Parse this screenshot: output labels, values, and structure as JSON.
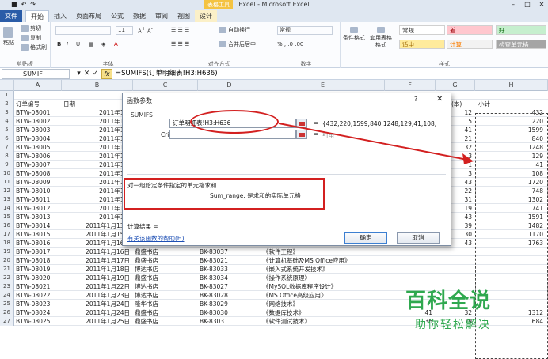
{
  "app": {
    "title": "Excel - Microsoft Excel",
    "context_tab": "表格工具",
    "qa_icons": [
      "save-icon",
      "undo-icon",
      "redo-icon"
    ]
  },
  "tabs": [
    "文件",
    "开始",
    "插入",
    "页面布局",
    "公式",
    "数据",
    "审阅",
    "视图",
    "设计"
  ],
  "ribbon": {
    "clipboard": {
      "cut": "剪切",
      "copy": "复制",
      "format_painter": "格式刷",
      "paste": "粘贴",
      "label": "剪贴板"
    },
    "font": {
      "size": "11",
      "bold": "B",
      "italic": "I",
      "underline": "U",
      "label": "字体"
    },
    "align": {
      "wrap": "自动换行",
      "merge": "合并后居中",
      "label": "对齐方式"
    },
    "number": {
      "format": "常规",
      "label": "数字"
    },
    "styles": {
      "cond": "条件格式",
      "table": "套用表格格式",
      "label": "样式",
      "boxes": [
        {
          "text": "常规",
          "bg": "#ffffff",
          "fg": "#333333"
        },
        {
          "text": "差",
          "bg": "#ffc7ce",
          "fg": "#9c0006"
        },
        {
          "text": "好",
          "bg": "#c6efce",
          "fg": "#006100"
        },
        {
          "text": "适中",
          "bg": "#ffeb9c",
          "fg": "#9c6500"
        },
        {
          "text": "计算",
          "bg": "#f2f2f2",
          "fg": "#fa7d00"
        },
        {
          "text": "检查单元格",
          "bg": "#a5a5a5",
          "fg": "#ffffff"
        }
      ]
    }
  },
  "formula_bar": {
    "name_box": "SUMIF",
    "cancel": "✕",
    "enter": "✓",
    "fx": "fx",
    "formula": "=SUMIFS(订单明细表!H3:H636)"
  },
  "columns": [
    "A",
    "B",
    "C",
    "D",
    "E",
    "F",
    "G",
    "H"
  ],
  "header_row": {
    "num": "2",
    "order": "订单编号",
    "date": "日期",
    "qty": "(本)",
    "subtotal": "小计"
  },
  "rows": [
    {
      "num": "3",
      "id": "BTW-08001",
      "date": "2011年1月",
      "store": "",
      "book": "",
      "title": "",
      "price": "",
      "qty": "12",
      "total": "432"
    },
    {
      "num": "4",
      "id": "BTW-08002",
      "date": "2011年1月",
      "store": "",
      "book": "",
      "title": "",
      "price": "",
      "qty": "5",
      "total": "220"
    },
    {
      "num": "5",
      "id": "BTW-08003",
      "date": "2011年1月",
      "store": "",
      "book": "",
      "title": "",
      "price": "",
      "qty": "41",
      "total": "1599"
    },
    {
      "num": "6",
      "id": "BTW-08004",
      "date": "2011年1月",
      "store": "",
      "book": "",
      "title": "",
      "price": "",
      "qty": "21",
      "total": "840"
    },
    {
      "num": "7",
      "id": "BTW-08005",
      "date": "2011年1月",
      "store": "",
      "book": "",
      "title": "",
      "price": "",
      "qty": "32",
      "total": "1248"
    },
    {
      "num": "8",
      "id": "BTW-08006",
      "date": "2011年1月",
      "store": "",
      "book": "",
      "title": "",
      "price": "",
      "qty": "3",
      "total": "129"
    },
    {
      "num": "9",
      "id": "BTW-08007",
      "date": "2011年1月",
      "store": "",
      "book": "",
      "title": "",
      "price": "",
      "qty": "1",
      "total": "41"
    },
    {
      "num": "10",
      "id": "BTW-08008",
      "date": "2011年1月",
      "store": "",
      "book": "",
      "title": "",
      "price": "",
      "qty": "3",
      "total": "108"
    },
    {
      "num": "11",
      "id": "BTW-08009",
      "date": "2011年1月",
      "store": "",
      "book": "",
      "title": "",
      "price": "",
      "qty": "43",
      "total": "1720"
    },
    {
      "num": "12",
      "id": "BTW-08010",
      "date": "2011年1月",
      "store": "",
      "book": "",
      "title": "",
      "price": "",
      "qty": "22",
      "total": "748"
    },
    {
      "num": "13",
      "id": "BTW-08011",
      "date": "2011年1月",
      "store": "",
      "book": "",
      "title": "",
      "price": "",
      "qty": "31",
      "total": "1302"
    },
    {
      "num": "14",
      "id": "BTW-08012",
      "date": "2011年1月",
      "store": "",
      "book": "",
      "title": "",
      "price": "",
      "qty": "19",
      "total": "741"
    },
    {
      "num": "15",
      "id": "BTW-08013",
      "date": "2011年1月",
      "store": "",
      "book": "",
      "title": "",
      "price": "",
      "qty": "43",
      "total": "1591"
    },
    {
      "num": "16",
      "id": "BTW-08014",
      "date": "2011年1月13日",
      "store": "隆华书店",
      "book": "BK-83024",
      "title": "《VB语言程序设计》",
      "price": "38",
      "qty": "39",
      "total": "1482"
    },
    {
      "num": "17",
      "id": "BTW-08015",
      "date": "2011年1月15日",
      "store": "鼎盛书店",
      "book": "BK-83025",
      "title": "《Java语言程序设计》",
      "price": "39",
      "qty": "30",
      "total": "1170"
    },
    {
      "num": "18",
      "id": "BTW-08016",
      "date": "2011年1月16日",
      "store": "鼎盛书店",
      "book": "BK-83026",
      "title": "《Access数据库程序设计》",
      "price": "41",
      "qty": "43",
      "total": "1763"
    },
    {
      "num": "19",
      "id": "BTW-08017",
      "date": "2011年1月16日",
      "store": "鼎盛书店",
      "book": "BK-83037",
      "title": "《软件工程》",
      "price": "",
      "qty": "",
      "total": ""
    },
    {
      "num": "20",
      "id": "BTW-08018",
      "date": "2011年1月17日",
      "store": "鼎盛书店",
      "book": "BK-83021",
      "title": "《计算机基础及MS Office应用》",
      "price": "",
      "qty": "",
      "total": ""
    },
    {
      "num": "21",
      "id": "BTW-08019",
      "date": "2011年1月18日",
      "store": "博达书店",
      "book": "BK-83033",
      "title": "《嵌入式系统开发技术》",
      "price": "",
      "qty": "",
      "total": ""
    },
    {
      "num": "22",
      "id": "BTW-08020",
      "date": "2011年1月19日",
      "store": "鼎盛书店",
      "book": "BK-83034",
      "title": "《操作系统原理》",
      "price": "",
      "qty": "",
      "total": ""
    },
    {
      "num": "23",
      "id": "BTW-08021",
      "date": "2011年1月22日",
      "store": "博达书店",
      "book": "BK-83027",
      "title": "《MySQL数据库程序设计》",
      "price": "",
      "qty": "",
      "total": ""
    },
    {
      "num": "24",
      "id": "BTW-08022",
      "date": "2011年1月23日",
      "store": "博达书店",
      "book": "BK-83028",
      "title": "《MS Office高级应用》",
      "price": "",
      "qty": "",
      "total": ""
    },
    {
      "num": "25",
      "id": "BTW-08023",
      "date": "2011年1月24日",
      "store": "隆华书店",
      "book": "BK-83029",
      "title": "《网络技术》",
      "price": "",
      "qty": "",
      "total": ""
    },
    {
      "num": "26",
      "id": "BTW-08024",
      "date": "2011年1月24日",
      "store": "鼎盛书店",
      "book": "BK-83030",
      "title": "《数据库技术》",
      "price": "41",
      "qty": "32",
      "total": "1312"
    },
    {
      "num": "27",
      "id": "BTW-08025",
      "date": "2011年1月25日",
      "store": "鼎盛书店",
      "book": "BK-83031",
      "title": "《软件测试技术》",
      "price": "36",
      "qty": "19",
      "total": "684"
    }
  ],
  "dialog": {
    "title": "函数参数",
    "help": "?",
    "close": "✕",
    "function": "SUMIFS",
    "sum_range": {
      "label": "Sum_range",
      "value": "订单明细表!H3:H636",
      "result": "{432;220;1599;840;1248;129;41;108;"
    },
    "criteria_range1": {
      "label": "Criteria_range1",
      "value": "",
      "result": "引用"
    },
    "eq": "=",
    "description": "对一组给定条件指定的单元格求和",
    "arg_description": "Sum_range:  是求和的实际单元格",
    "result_label": "计算结果 =",
    "help_link": "有关该函数的帮助(H)",
    "ok": "确定",
    "cancel": "取消"
  },
  "watermark": {
    "title": "百科全说",
    "subtitle": "助你轻松解决"
  },
  "colors": {
    "accent": "#2a5ca8",
    "annotation": "#d32020",
    "watermark": "#2fa84f"
  }
}
